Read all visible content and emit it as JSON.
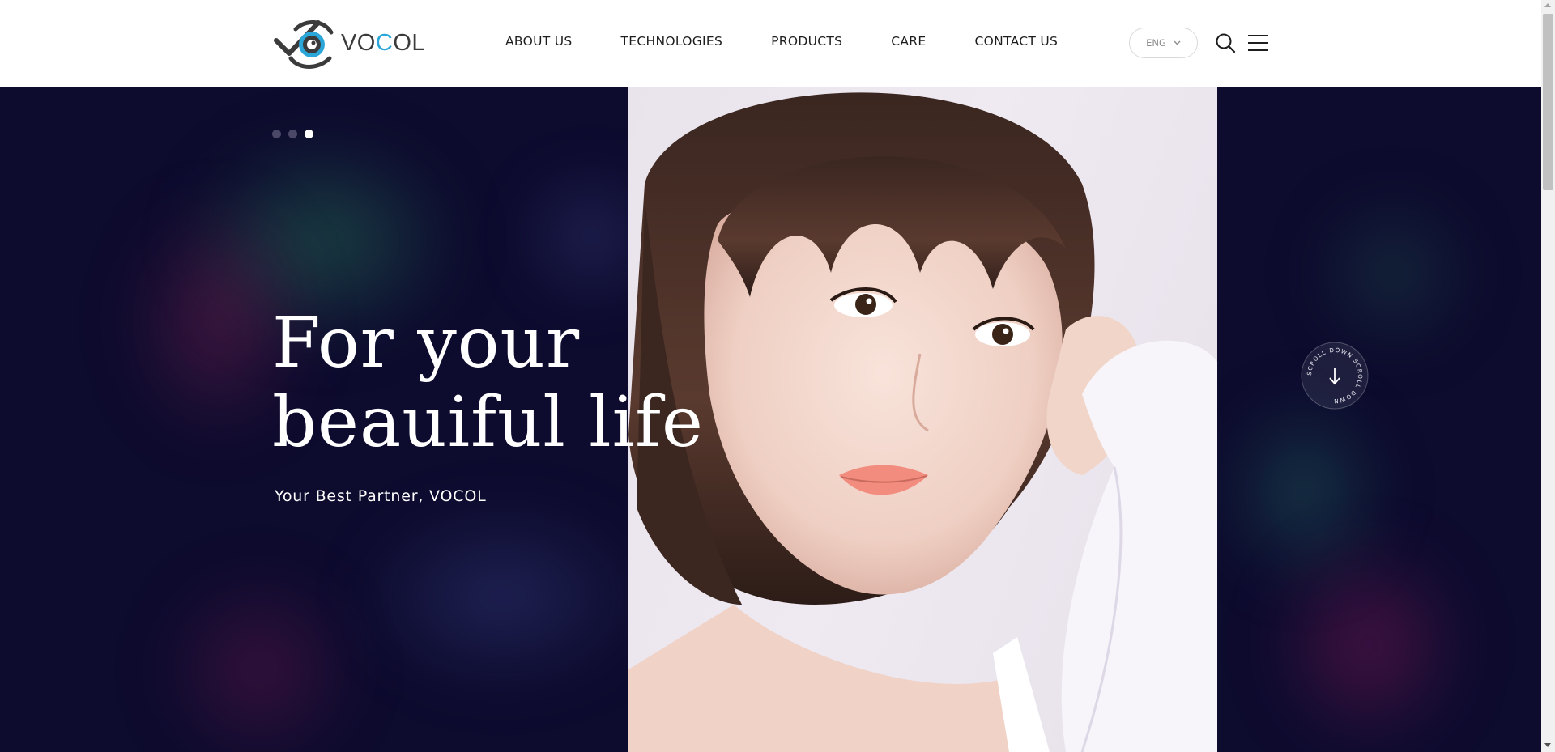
{
  "brand": {
    "name_part1": "VO",
    "name_accent": "C",
    "name_part2": "OL",
    "logo_icon": "eye-logo-icon",
    "colors": {
      "accent": "#2aa7d8",
      "dark": "#3b3b3b"
    }
  },
  "nav": {
    "items": [
      {
        "label": "ABOUT US"
      },
      {
        "label": "TECHNOLOGIES"
      },
      {
        "label": "PRODUCTS"
      },
      {
        "label": "CARE"
      },
      {
        "label": "CONTACT US"
      }
    ]
  },
  "header_tools": {
    "language": "ENG",
    "language_icon": "chevron-down-icon",
    "search_icon": "search-icon",
    "menu_icon": "hamburger-menu-icon"
  },
  "hero": {
    "slide_count": 3,
    "active_slide": 3,
    "headline_line1": "For your",
    "headline_line2": "beauiful life",
    "subline": "Your Best Partner, VOCOL",
    "scroll_label": "SCROLL DOWN",
    "scroll_icon": "arrow-down-icon",
    "colors": {
      "background": "#0d0b2e",
      "text": "#ffffff"
    }
  }
}
